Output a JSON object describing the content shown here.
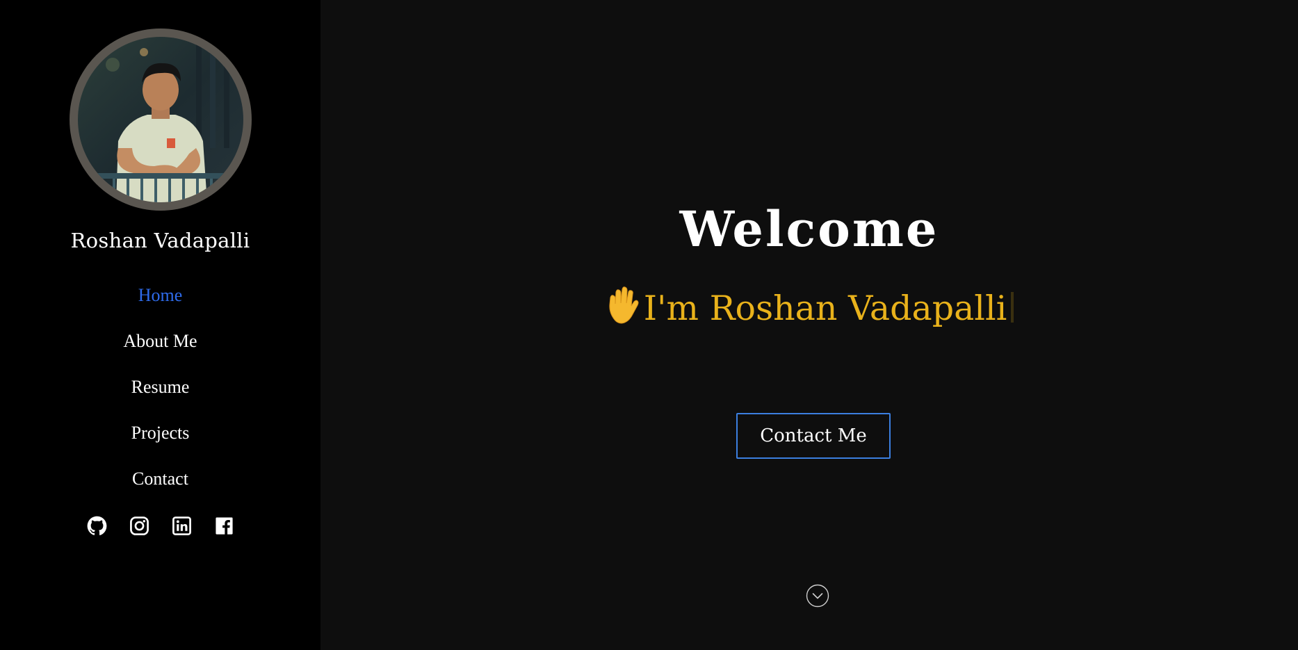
{
  "sidebar": {
    "name": "Roshan Vadapalli",
    "nav": [
      {
        "label": "Home",
        "active": true
      },
      {
        "label": "About Me",
        "active": false
      },
      {
        "label": "Resume",
        "active": false
      },
      {
        "label": "Projects",
        "active": false
      },
      {
        "label": "Contact",
        "active": false
      }
    ],
    "social_icons": [
      "github-icon",
      "instagram-icon",
      "linkedin-icon",
      "facebook-icon"
    ]
  },
  "hero": {
    "title": "Welcome",
    "typed_text": "I'm Roshan Vadapalli",
    "greeting_icon": "raised-hand-icon",
    "contact_label": "Contact Me",
    "scroll_icon": "chevron-down-circle-icon"
  },
  "colors": {
    "sidebar_bg": "#000000",
    "main_bg": "#0e0e0e",
    "active_nav": "#2e6bea",
    "typed_text": "#e9b21b",
    "button_border": "#3b7fe0",
    "avatar_ring": "#5a5650"
  }
}
